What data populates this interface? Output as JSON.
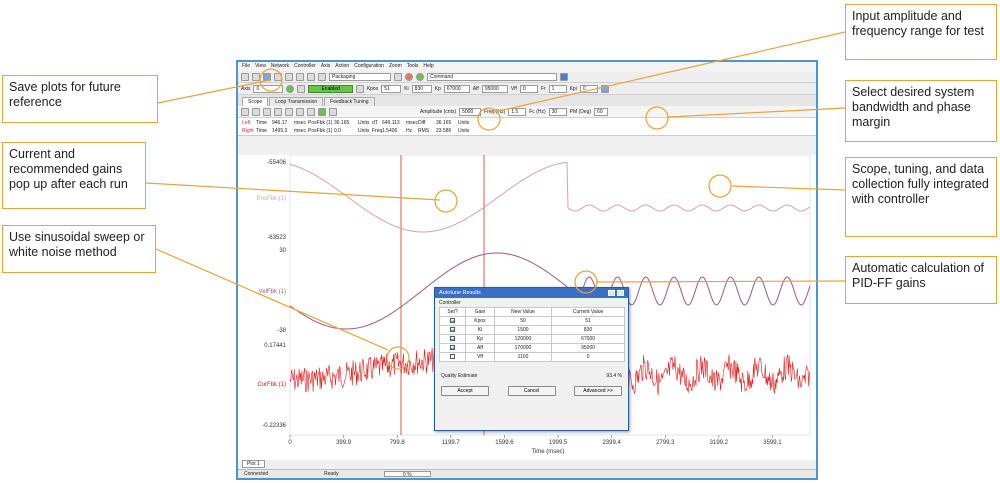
{
  "annotations": {
    "save_plots": "Save plots for future reference",
    "gains_popup": "Current and recommended gains pop up after each run",
    "sweep_method": "Use sinusoidal sweep or white noise method",
    "input_amplitude": "Input amplitude and frequency range for test",
    "bandwidth": "Select desired system bandwidth and phase margin",
    "integrated": "Scope, tuning, and data collection fully integrated with controller",
    "auto_calc": "Automatic calculation of PID-FF gains"
  },
  "app": {
    "menu": [
      "File",
      "View",
      "Network",
      "Controller",
      "Axis",
      "Action",
      "Configuration",
      "Zoom",
      "Tools",
      "Help"
    ],
    "toolbar1": {
      "project_dropdown": "Packaging",
      "command_field": "Command"
    },
    "toolbar2": {
      "axis_label": "Axis",
      "axis_value": "0",
      "enabled_label": "Enabled",
      "fields": [
        {
          "label": "Kpos",
          "value": "51"
        },
        {
          "label": "Ki",
          "value": "830"
        },
        {
          "label": "Kp",
          "value": "67000"
        },
        {
          "label": "Aff",
          "value": "95000"
        },
        {
          "label": "Vff",
          "value": "0"
        },
        {
          "label": "Fr",
          "value": "1"
        },
        {
          "label": "Kpi",
          "value": "0"
        }
      ]
    },
    "tabs": [
      "Scope",
      "Loop Transmission",
      "Feedback Tuning"
    ],
    "tuning_bar": {
      "amplitude_label": "Amplitude (cnts)",
      "amplitude_value": "5000",
      "freq_label": "Freq (Hz)",
      "freq_value": "1.5",
      "fc_label": "Fc (Hz)",
      "fc_value": "30",
      "pm_label": "PM (Deg)",
      "pm_value": "60"
    },
    "cursors": {
      "left": [
        "Left",
        "Time",
        "946.17",
        "msec",
        "PosFbk (1)",
        "36.165",
        "Units",
        "dT",
        "649.113",
        "msec",
        "Diff",
        "36.165",
        "Units"
      ],
      "right": [
        "Right",
        "Time",
        "1495.3",
        "msec",
        "PosFbk (1)",
        "0.0",
        "Units",
        "Freq",
        "1.5406",
        "Hz",
        "RMS",
        "23.586",
        "Units"
      ]
    },
    "plot": {
      "channels": [
        {
          "name": "PosFbk (1)",
          "ymax": "-55406",
          "ymin": "-63523",
          "color": "#d9a0b5"
        },
        {
          "name": "VelFbk (1)",
          "ymax": "30",
          "ymin": "-38",
          "color": "#9a5a86"
        },
        {
          "name": "CurFbk (1)",
          "ymax": "0.17441",
          "ymin": "-0.22336",
          "color": "#e31a1c"
        }
      ],
      "x_ticks": [
        "0",
        "399.9",
        "799.8",
        "1199.7",
        "1599.6",
        "1999.5",
        "2399.4",
        "2799.3",
        "3199.2",
        "3599.1"
      ],
      "x_label": "Time (msec)",
      "plot_tab": "Plot 1"
    },
    "status": {
      "connection": "Connected",
      "state": "Ready",
      "progress": "0 %"
    },
    "dialog": {
      "title": "Autotune Results",
      "group": "Controller",
      "headers": [
        "Set?",
        "Gain",
        "New Value",
        "Current Value"
      ],
      "rows": [
        {
          "set": true,
          "gain": "Kpos",
          "new": "50",
          "current": "51"
        },
        {
          "set": true,
          "gain": "Ki",
          "new": "1500",
          "current": "830"
        },
        {
          "set": true,
          "gain": "Kp",
          "new": "120000",
          "current": "67000"
        },
        {
          "set": true,
          "gain": "Aff",
          "new": "170000",
          "current": "95000"
        },
        {
          "set": false,
          "gain": "Vff",
          "new": "1100",
          "current": "0"
        }
      ],
      "quality_label": "Quality Estimate",
      "quality_value": "93.4 %",
      "buttons": [
        "Accept",
        "Cancel",
        "Advanced >>"
      ]
    }
  }
}
